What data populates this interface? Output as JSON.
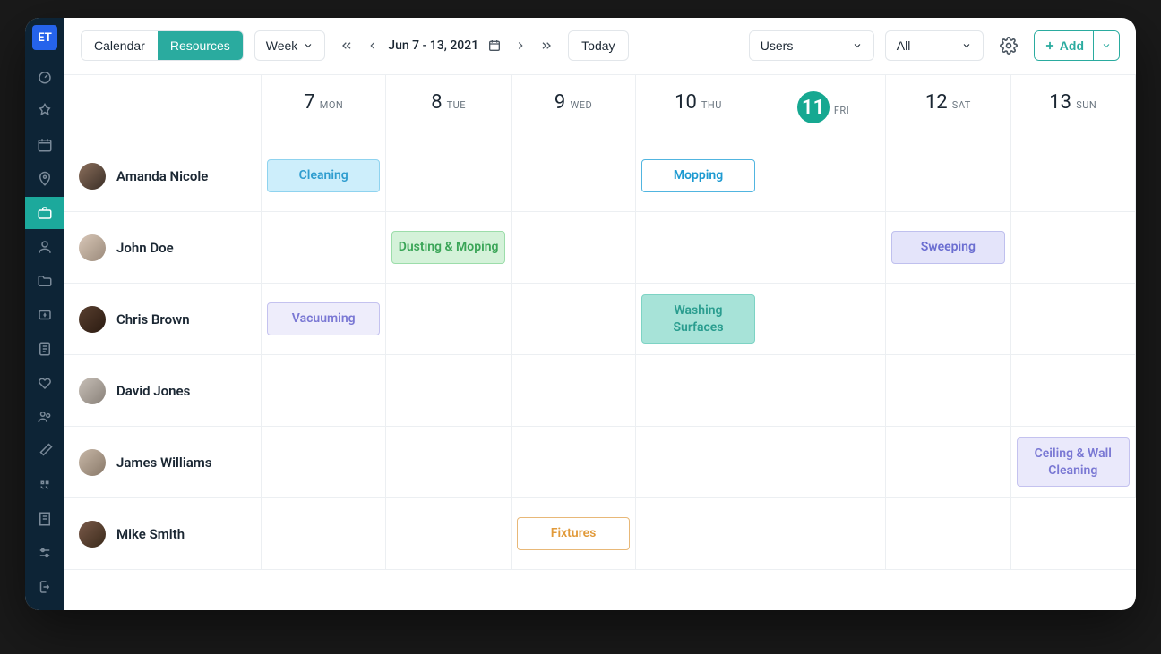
{
  "logo": "ET",
  "tabs": {
    "calendar": "Calendar",
    "resources": "Resources"
  },
  "view_selector": "Week",
  "date_range": "Jun 7 - 13, 2021",
  "today_btn": "Today",
  "filter_users": "Users",
  "filter_all": "All",
  "add_btn": "Add",
  "days": [
    {
      "num": "7",
      "dow": "MON",
      "today": false
    },
    {
      "num": "8",
      "dow": "TUE",
      "today": false
    },
    {
      "num": "9",
      "dow": "WED",
      "today": false
    },
    {
      "num": "10",
      "dow": "THU",
      "today": false
    },
    {
      "num": "11",
      "dow": "FRI",
      "today": true
    },
    {
      "num": "12",
      "dow": "SAT",
      "today": false
    },
    {
      "num": "13",
      "dow": "SUN",
      "today": false
    }
  ],
  "rows": [
    {
      "name": "Amanda Nicole",
      "avatar_bg": "linear-gradient(135deg,#8b6f5c,#3a2e26)",
      "tasks": [
        {
          "day": 0,
          "label": "Cleaning",
          "bg": "#cdeefb",
          "fg": "#2f9dcf",
          "border": "#8fd3ef"
        },
        {
          "day": 3,
          "label": "Mopping",
          "bg": "#ffffff",
          "fg": "#1d9ad1",
          "border": "#51b5e0"
        }
      ]
    },
    {
      "name": "John Doe",
      "avatar_bg": "linear-gradient(135deg,#d9c7b8,#9a8a7a)",
      "tasks": [
        {
          "day": 1,
          "label": "Dusting & Moping",
          "bg": "#d4f2d9",
          "fg": "#3aa557",
          "border": "#9cddaa"
        },
        {
          "day": 5,
          "label": "Sweeping",
          "bg": "#e4e4fa",
          "fg": "#6b6ed1",
          "border": "#bfc0ee"
        }
      ]
    },
    {
      "name": "Chris Brown",
      "avatar_bg": "linear-gradient(135deg,#5a4030,#2a1a10)",
      "tasks": [
        {
          "day": 0,
          "label": "Vacuuming",
          "bg": "#eeedfb",
          "fg": "#7a78d4",
          "border": "#c4c2ef"
        },
        {
          "day": 3,
          "label": "Washing Surfaces",
          "bg": "#a7e3d8",
          "fg": "#2a9d8f",
          "border": "#7dd3c4"
        }
      ]
    },
    {
      "name": "David Jones",
      "avatar_bg": "linear-gradient(135deg,#c8c0b8,#888078)",
      "tasks": []
    },
    {
      "name": "James Williams",
      "avatar_bg": "linear-gradient(135deg,#c8b8a8,#887868)",
      "tasks": [
        {
          "day": 6,
          "label": "Ceiling & Wall Cleaning",
          "bg": "#eae9fb",
          "fg": "#7a78d4",
          "border": "#c4c2ef"
        }
      ]
    },
    {
      "name": "Mike Smith",
      "avatar_bg": "linear-gradient(135deg,#7a5a4a,#3a2a1a)",
      "tasks": [
        {
          "day": 2,
          "label": "Fixtures",
          "bg": "#ffffff",
          "fg": "#e19a3a",
          "border": "#e8b878"
        }
      ]
    }
  ]
}
